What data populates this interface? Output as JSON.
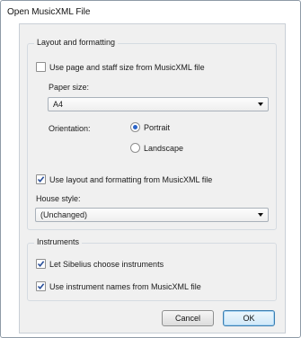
{
  "window": {
    "title": "Open MusicXML File"
  },
  "layout_group": {
    "legend": "Layout and formatting",
    "use_page_size": {
      "label": "Use page and staff size from MusicXML file",
      "checked": false
    },
    "paper_size": {
      "label": "Paper size:",
      "value": "A4"
    },
    "orientation": {
      "label": "Orientation:",
      "options": [
        {
          "label": "Portrait",
          "selected": true
        },
        {
          "label": "Landscape",
          "selected": false
        }
      ]
    },
    "use_layout": {
      "label": "Use layout and formatting from MusicXML file",
      "checked": true
    },
    "house_style": {
      "label": "House style:",
      "value": "(Unchanged)"
    }
  },
  "instruments_group": {
    "legend": "Instruments",
    "let_sibelius": {
      "label": "Let Sibelius choose instruments",
      "checked": true
    },
    "use_names": {
      "label": "Use instrument names from MusicXML file",
      "checked": true
    }
  },
  "buttons": {
    "cancel": "Cancel",
    "ok": "OK"
  }
}
